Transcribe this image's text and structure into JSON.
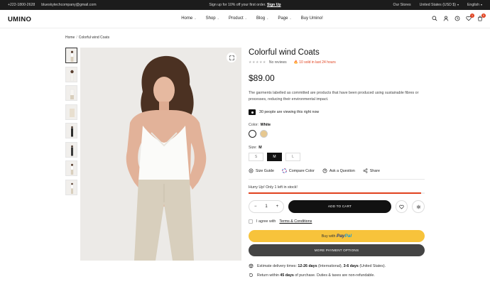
{
  "topbar": {
    "phone": "+222-1800-2628",
    "email": "blueskytechcompany@gmail.com",
    "promo_text": "Sign up for 10% off your first order.",
    "promo_link": "Sign Up",
    "stores": "Our Stores",
    "currency": "United States (USD $)",
    "language": "English"
  },
  "header": {
    "logo": "UMINO",
    "nav": [
      {
        "label": "Home",
        "dropdown": true
      },
      {
        "label": "Shop",
        "dropdown": true
      },
      {
        "label": "Product",
        "dropdown": true
      },
      {
        "label": "Blog",
        "dropdown": true
      },
      {
        "label": "Page",
        "dropdown": true
      },
      {
        "label": "Buy Umino!",
        "dropdown": false
      }
    ],
    "compare_count": "1",
    "cart_count": "0"
  },
  "breadcrumb": {
    "home": "Home",
    "separator": "/",
    "current": "Colorful wind Coats"
  },
  "product": {
    "title": "Colorful wind Coats",
    "reviews": "No reviews",
    "sold": "10 sold in last 24 hours",
    "price": "$89.00",
    "description": "The garments labelled as committed are products that have been produced using sustainable fibres or processes, reducing their environmental impact.",
    "viewing": "30 people are viewing this right now",
    "color_label": "Color:",
    "color_value": "White",
    "colors": [
      "#ffffff",
      "#e7c890"
    ],
    "size_label": "Size:",
    "size_value": "M",
    "sizes": [
      "S",
      "M",
      "L"
    ],
    "active_size": "M",
    "links": {
      "size_guide": "Size Guide",
      "compare": "Compare Color",
      "ask": "Ask a Question",
      "share": "Share"
    },
    "stock_text": "Hurry Up! Only 1 left in stock!",
    "stock_fill": 0.98,
    "quantity": "1",
    "add_to_cart": "ADD TO CART",
    "agree_text": "I agree with",
    "terms": "Terms & Conditions",
    "buy_with": "Buy with",
    "paypal_a": "Pay",
    "paypal_b": "Pal",
    "more_options": "MORE PAYMENT OPTIONS",
    "delivery_prefix": "Estimate delivery times:",
    "delivery_intl": "12-26 days",
    "delivery_intl_suffix": "(International),",
    "delivery_us": "3-6 days",
    "delivery_us_suffix": "(United States).",
    "return_prefix": "Return within",
    "return_days": "45 days",
    "return_suffix": "of purchase. Duties & taxes are non-refundable."
  },
  "colors": {
    "accent": "#e0411e",
    "dark": "#111111",
    "paypal_yellow": "#f7c33b"
  }
}
